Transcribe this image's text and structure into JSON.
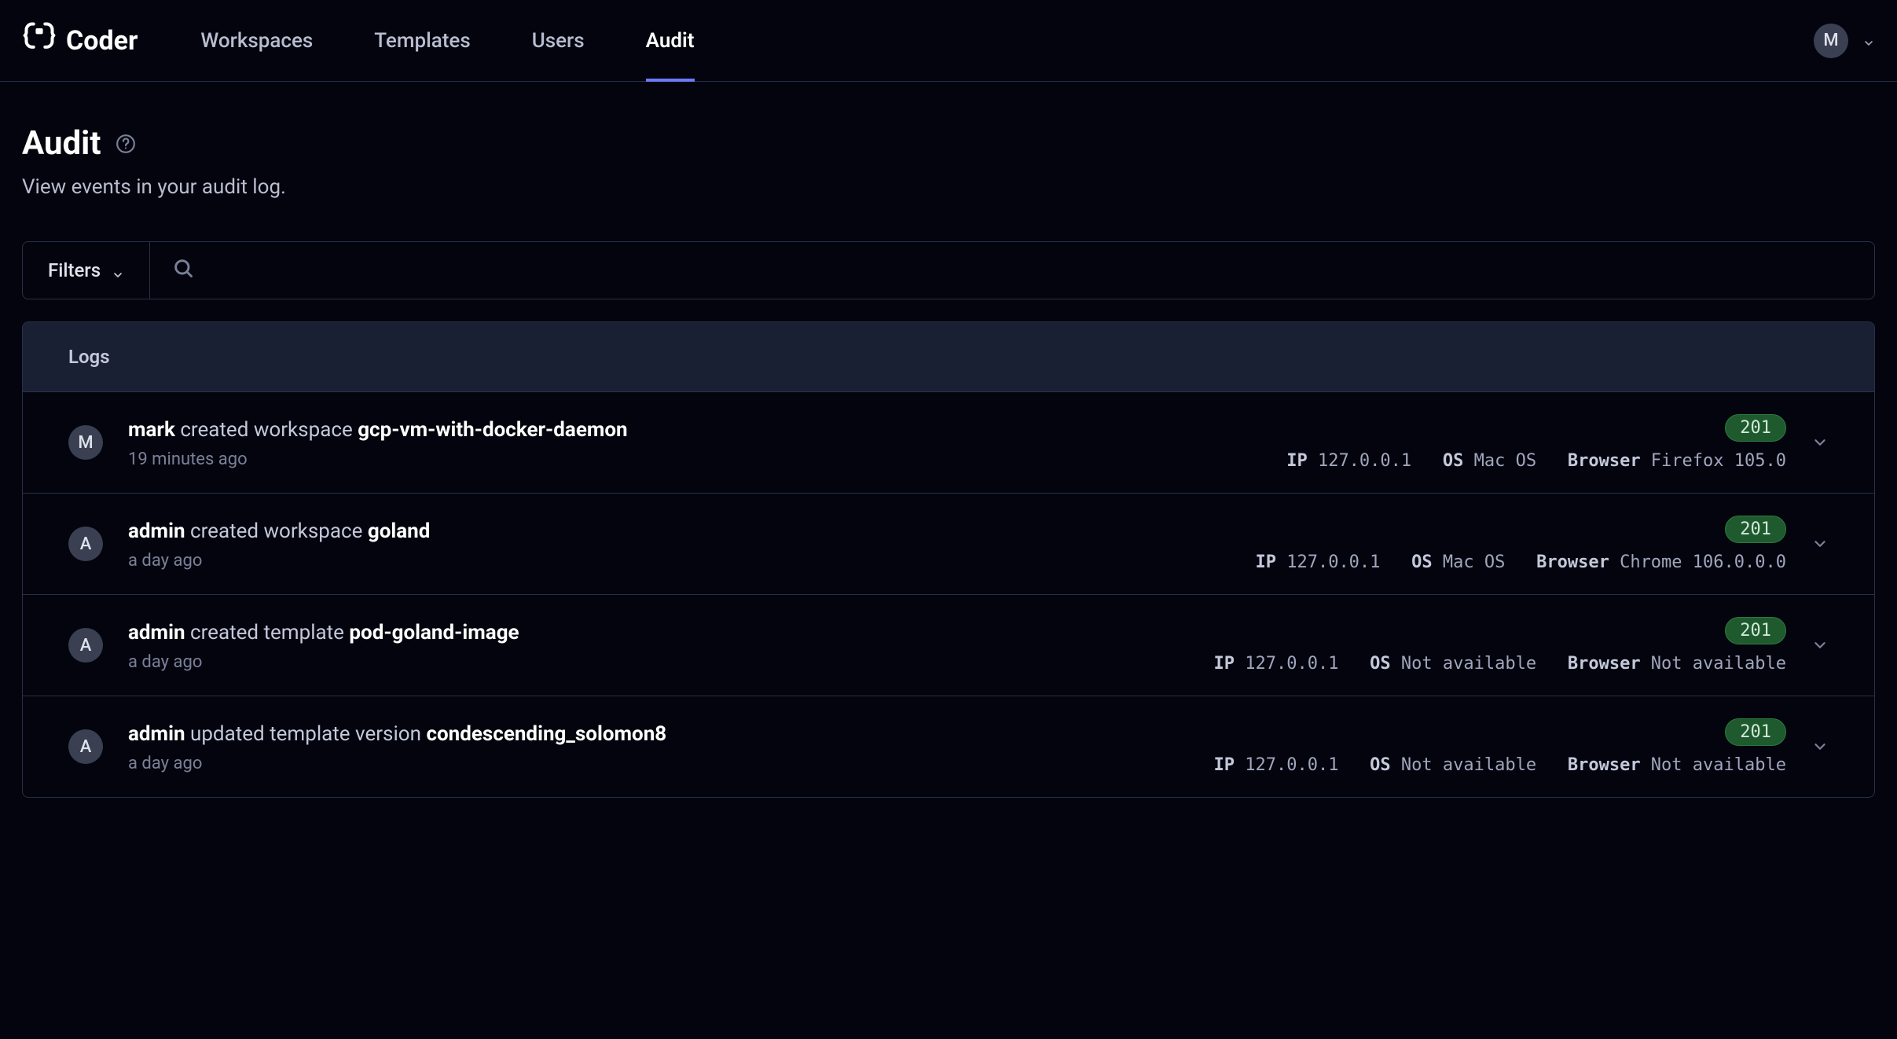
{
  "brand": "Coder",
  "nav": {
    "items": [
      {
        "label": "Workspaces",
        "active": false
      },
      {
        "label": "Templates",
        "active": false
      },
      {
        "label": "Users",
        "active": false
      },
      {
        "label": "Audit",
        "active": true
      }
    ]
  },
  "user": {
    "initial": "M"
  },
  "page": {
    "title": "Audit",
    "subtitle": "View events in your audit log."
  },
  "filter": {
    "button_label": "Filters",
    "search_value": ""
  },
  "logs": {
    "header": "Logs",
    "labels": {
      "ip": "IP",
      "os": "OS",
      "browser": "Browser"
    },
    "rows": [
      {
        "avatar": "M",
        "actor": "mark",
        "action": "created workspace",
        "target": "gcp-vm-with-docker-daemon",
        "time": "19 minutes ago",
        "ip": "127.0.0.1",
        "os": "Mac OS",
        "browser": "Firefox 105.0",
        "status": "201"
      },
      {
        "avatar": "A",
        "actor": "admin",
        "action": "created workspace",
        "target": "goland",
        "time": "a day ago",
        "ip": "127.0.0.1",
        "os": "Mac OS",
        "browser": "Chrome 106.0.0.0",
        "status": "201"
      },
      {
        "avatar": "A",
        "actor": "admin",
        "action": "created template",
        "target": "pod-goland-image",
        "time": "a day ago",
        "ip": "127.0.0.1",
        "os": "Not available",
        "browser": "Not available",
        "status": "201"
      },
      {
        "avatar": "A",
        "actor": "admin",
        "action": "updated template version",
        "target": "condescending_solomon8",
        "time": "a day ago",
        "ip": "127.0.0.1",
        "os": "Not available",
        "browser": "Not available",
        "status": "201"
      }
    ]
  }
}
